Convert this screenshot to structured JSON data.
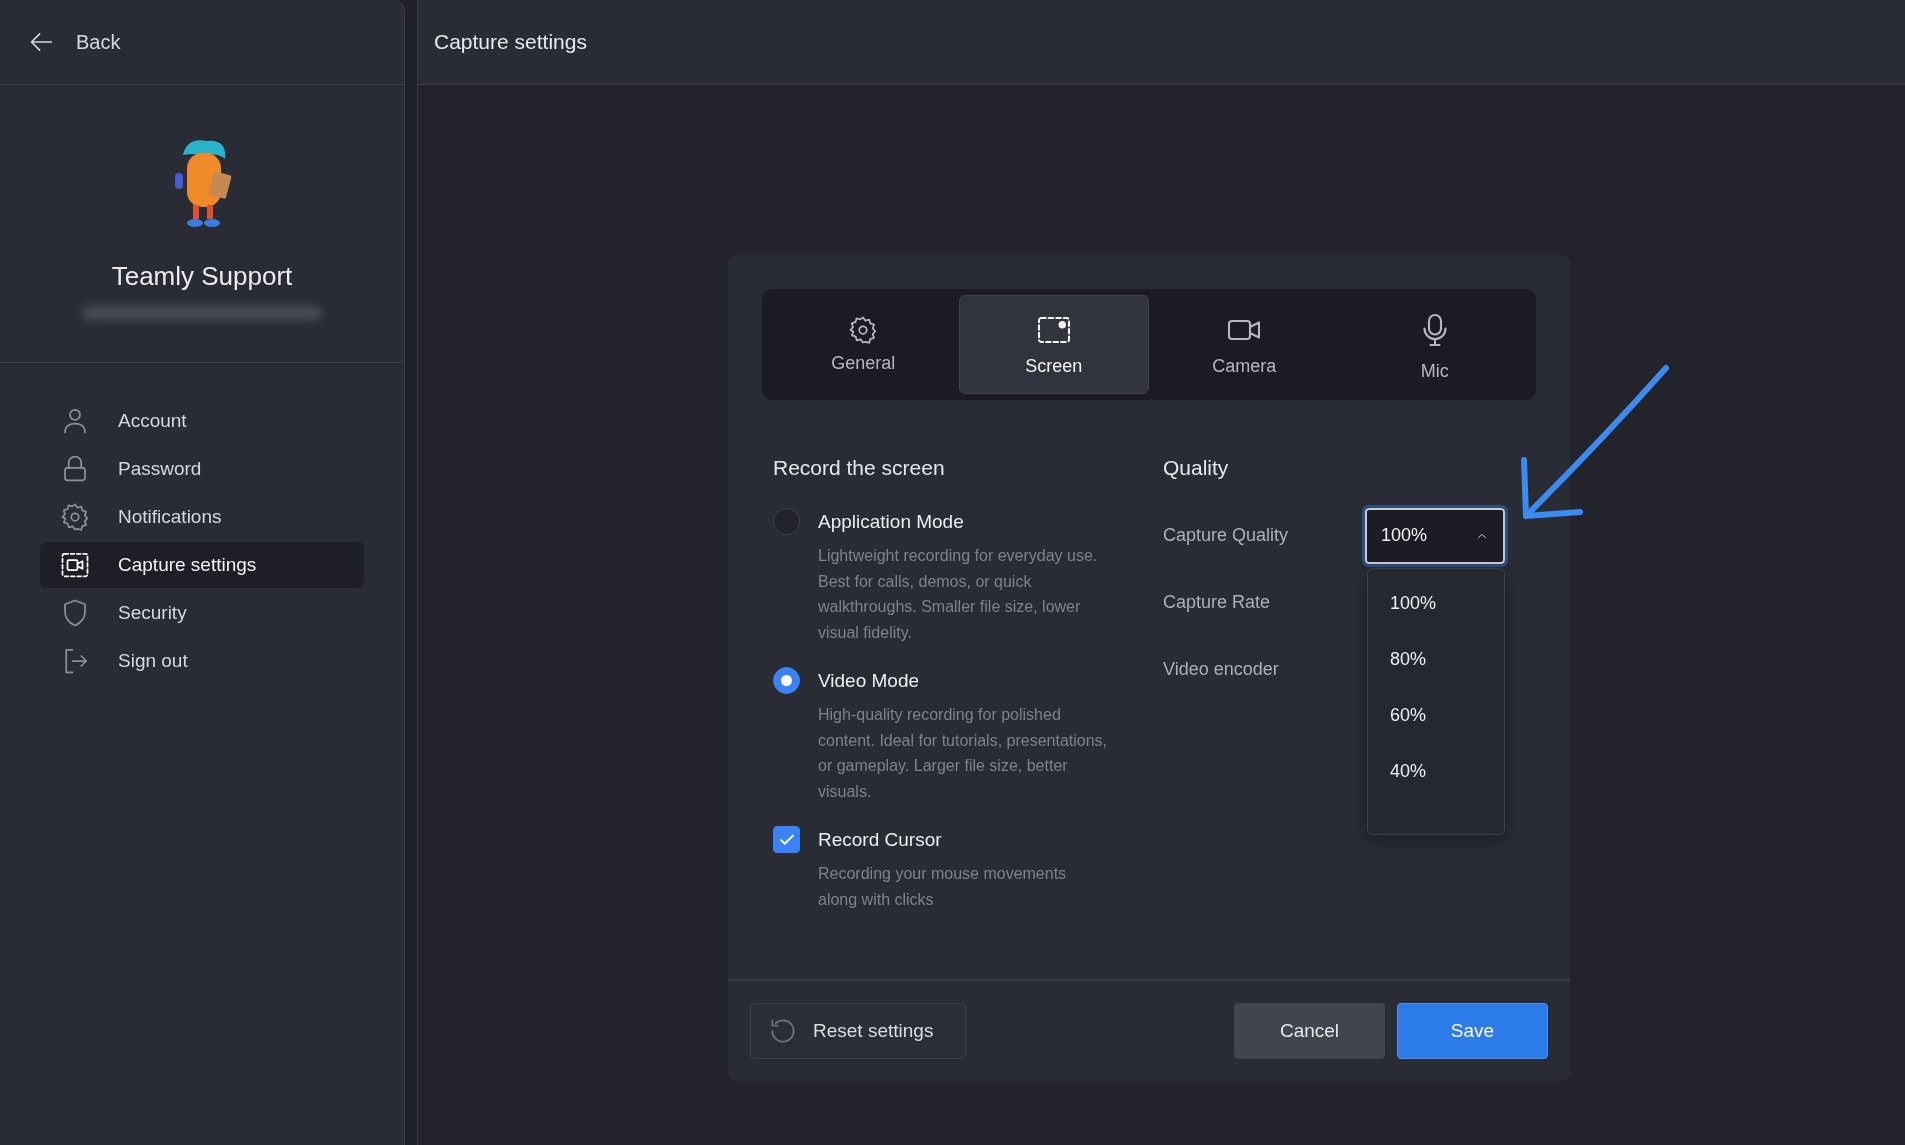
{
  "back": {
    "label": "Back"
  },
  "profile": {
    "name": "Teamly Support"
  },
  "sidebar": {
    "items": [
      {
        "kind": "account",
        "label": "Account",
        "selected": false
      },
      {
        "kind": "password",
        "label": "Password",
        "selected": false
      },
      {
        "kind": "notifications",
        "label": "Notifications",
        "selected": false
      },
      {
        "kind": "capture",
        "label": "Capture settings",
        "selected": true
      },
      {
        "kind": "security",
        "label": "Security",
        "selected": false
      },
      {
        "kind": "signout",
        "label": "Sign out",
        "selected": false
      }
    ]
  },
  "header": {
    "title": "Capture settings"
  },
  "dialog": {
    "tabs": [
      {
        "kind": "general",
        "label": "General",
        "selected": false
      },
      {
        "kind": "screen",
        "label": "Screen",
        "selected": true
      },
      {
        "kind": "camera",
        "label": "Camera",
        "selected": false
      },
      {
        "kind": "mic",
        "label": "Mic",
        "selected": false
      }
    ],
    "record": {
      "title": "Record the screen",
      "options": [
        {
          "kind": "radio",
          "label": "Application Mode",
          "description": "Lightweight recording for everyday use. Best for calls, demos, or quick walkthroughs. Smaller file size, lower visual fidelity.",
          "selected": false
        },
        {
          "kind": "radio",
          "label": "Video Mode",
          "description": "High-quality recording for polished content. Ideal for tutorials, presentations, or gameplay. Larger file size, better visuals.",
          "selected": true
        },
        {
          "kind": "checkbox",
          "label": "Record Cursor",
          "description": "Recording your mouse movements along with clicks",
          "checked": true
        }
      ]
    },
    "quality": {
      "title": "Quality",
      "fields": [
        {
          "label": "Capture Quality",
          "value": "100%",
          "expanded": true,
          "options": [
            "100%",
            "80%",
            "60%",
            "40%"
          ]
        },
        {
          "label": "Capture Rate"
        },
        {
          "label": "Video encoder"
        }
      ]
    },
    "footer": {
      "reset": "Reset settings",
      "cancel": "Cancel",
      "save": "Save"
    }
  }
}
